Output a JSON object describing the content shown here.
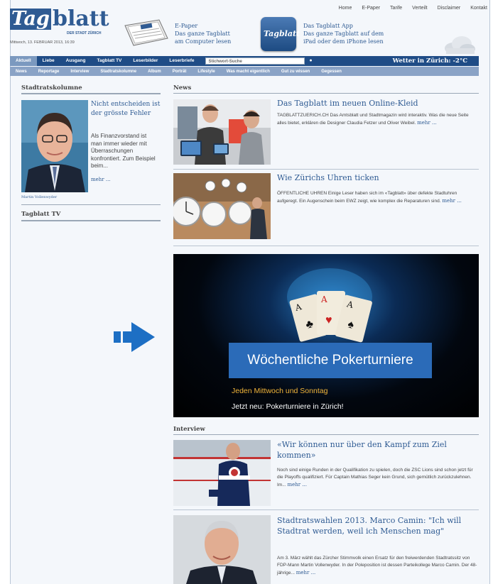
{
  "header": {
    "top_links": [
      "Home",
      "E-Paper",
      "Tarife",
      "Verteilt",
      "Disclaimer",
      "Kontakt"
    ],
    "logo_text_1": "Tag",
    "logo_text_2": "blatt",
    "logo_sub": "DER STADT ZÜRICH",
    "date": "Mittwoch, 13. FEBRUAR 2013, 16:39",
    "epaper": {
      "line1": "E-Paper",
      "line2": "Das ganze Tagblatt",
      "line3": "am Computer lesen"
    },
    "app": {
      "icon_label": "Tagblatt",
      "line1": "Das Tagblatt App",
      "line2": "Das ganze Tagblatt auf dem",
      "line3": "iPad oder dem iPhone lesen"
    },
    "weather_icon": "cloud-icon"
  },
  "nav1": {
    "items": [
      "Aktuell",
      "Liebe",
      "Ausgang",
      "Tagblatt TV",
      "Leserbilder",
      "Leserbriefe"
    ],
    "search_placeholder": "Stichwort-Suche",
    "weather": "Wetter in Zürich: -2°C"
  },
  "nav2": {
    "items": [
      "News",
      "Reportage",
      "Interview",
      "Stadtratskolumne",
      "Album",
      "Porträt",
      "Lifestyle",
      "Was macht eigentlich",
      "Gut zu wissen",
      "Gegessen"
    ]
  },
  "sidebar": {
    "column_heading": "Stadtratskolumne",
    "column_title": "Nicht entscheiden ist der grösste Fehler",
    "column_text": "Als Finanzvorstand ist man immer wieder mit Überraschungen konfrontiert. Zum Beispiel beim...",
    "mehr": "mehr ...",
    "caption": "Martin Vollenwyder",
    "tv_heading": "Tagblatt TV"
  },
  "main": {
    "news_heading": "News",
    "articles": [
      {
        "title": "Das Tagblatt im neuen Online-Kleid",
        "text": "TAGBLATTZUERICH.CH Das Amtsblatt und Stadtmagazin wird interaktiv. Was die neue Seite alles bietet, erklären die Designer Claudia Fetzer und Oliver Weibel.",
        "mehr": "mehr ..."
      },
      {
        "title": "Wie Zürichs Uhren ticken",
        "text": "ÖFFENTLICHE UHREN Einige Leser haben sich im «Tagblatt» über defekte Stadtuhren aufgeregt. Ein Augenschein beim EWZ zeigt, wie komplex die Reparaturen sind.",
        "mehr": "mehr ..."
      }
    ],
    "banner": {
      "title": "Wöchentliche Pokerturniere",
      "line1": "Jeden Mittwoch und Sonntag",
      "line2": "Jetzt neu: Pokerturniere in Zürich!"
    },
    "interview_heading": "Interview",
    "interviews": [
      {
        "title": "«Wir können nur über den Kampf zum Ziel kommen»",
        "text": "Noch sind einige Runden in der Qualifikation zu spielen, doch die ZSC Lions sind schon jetzt für die Playoffs qualifiziert. Für Captain Mathias Seger kein Grund, sich gemütlich zurückzulehnen. Im...",
        "mehr": "mehr ..."
      },
      {
        "title": "Stadtratswahlen 2013. Marco Camin: \"Ich will Stadtrat werden, weil ich Menschen mag\"",
        "text": "Am 3. März wählt das Zürcher Stimmvolk einen Ersatz für den freiwerdenden Stadtratssitz von FDP-Mann Martin Vollenwyder. In der Poleposition ist dessen Parteikollege Marco Camin. Der 48-jährige...",
        "mehr": "mehr ..."
      }
    ]
  },
  "colors": {
    "brand": "#2f5b93",
    "nav_dark": "#1f4c86",
    "nav_light": "#8aa3c6",
    "arrow": "#1d6fc4"
  }
}
